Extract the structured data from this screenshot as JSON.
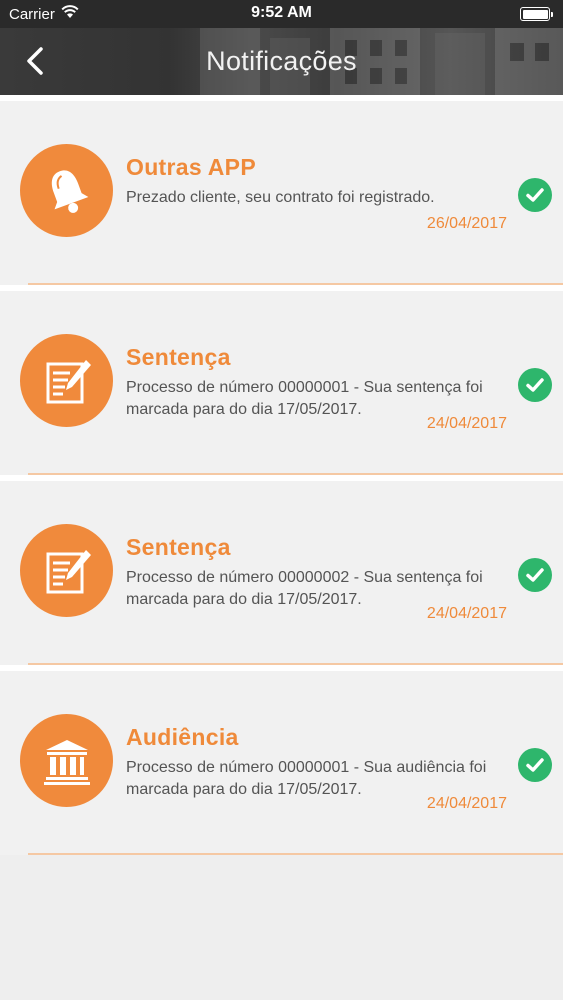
{
  "status_bar": {
    "carrier": "Carrier",
    "time": "9:52 AM"
  },
  "nav": {
    "title": "Notificações"
  },
  "notifications": [
    {
      "title": "Outras APP",
      "text": "Prezado cliente, seu contrato foi registrado.",
      "date": "26/04/2017",
      "icon": "bell-icon",
      "read": true
    },
    {
      "title": "Sentença",
      "text": "Processo de número 00000001 - Sua sentença foi marcada para do dia 17/05/2017.",
      "date": "24/04/2017",
      "icon": "document-edit-icon",
      "read": true
    },
    {
      "title": "Sentença",
      "text": "Processo de número 00000002 - Sua sentença foi marcada para do dia 17/05/2017.",
      "date": "24/04/2017",
      "icon": "document-edit-icon",
      "read": true
    },
    {
      "title": "Audiência",
      "text": "Processo de número 00000001 - Sua audiência foi marcada para do dia 17/05/2017.",
      "date": "24/04/2017",
      "icon": "courthouse-icon",
      "read": true
    }
  ],
  "colors": {
    "accent": "#f08a3c",
    "check": "#2eb66c",
    "nav": "#3a3a3a"
  }
}
